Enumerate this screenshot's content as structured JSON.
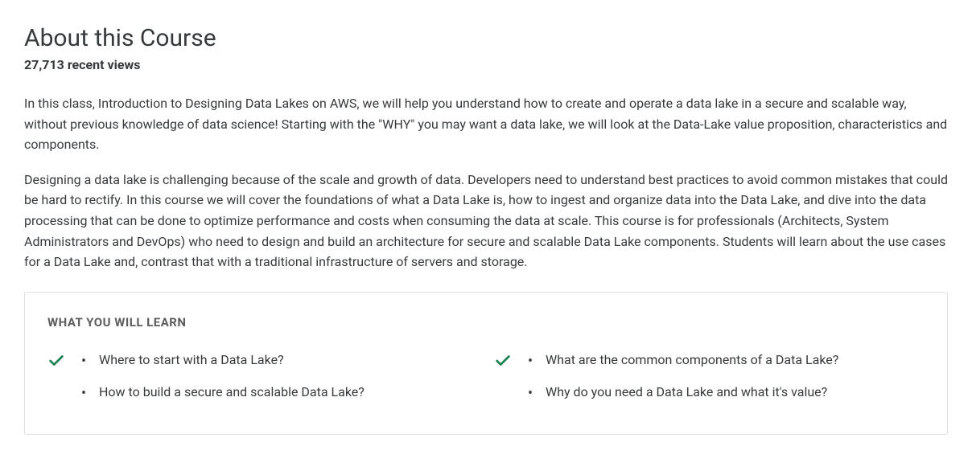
{
  "header": {
    "title": "About this Course",
    "views": "27,713 recent views"
  },
  "description": {
    "p1": "In this class, Introduction to Designing Data Lakes on AWS, we will help you understand how to create and operate a data lake in a secure and scalable way, without previous knowledge of data science! Starting with the \"WHY\" you may want a data lake, we will look at the Data-Lake value proposition, characteristics and components.",
    "p2": "Designing a data lake is challenging because of the scale and growth of data. Developers need to understand best practices to avoid common mistakes that could be hard to rectify. In this course we will cover the foundations of what a Data Lake is, how to ingest and organize data into the Data Lake, and dive into the data processing that can be done to optimize performance and costs when consuming the data at scale. This course is for professionals (Architects, System Administrators and DevOps) who need to design and build an architecture for secure and scalable Data Lake components. Students will learn about the use cases for a Data Lake and, contrast that with a traditional infrastructure of servers and storage."
  },
  "wywl": {
    "heading": "WHAT YOU WILL LEARN",
    "columns": [
      {
        "items": [
          "Where to start with a Data Lake?",
          "How to build a secure and scalable Data Lake?"
        ]
      },
      {
        "items": [
          "What are the common components of a Data Lake?",
          "Why do you need a Data Lake and what it's value?"
        ]
      }
    ]
  }
}
